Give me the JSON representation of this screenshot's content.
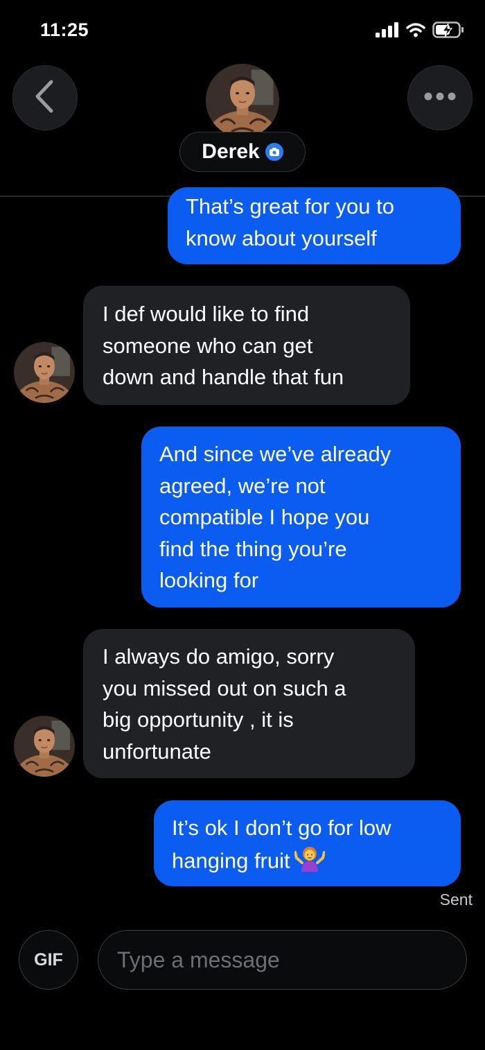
{
  "status_bar": {
    "time": "11:25",
    "icons": [
      "signal-icon",
      "wifi-icon",
      "battery-charging-icon"
    ]
  },
  "header": {
    "contact_name": "Derek",
    "back_icon": "chevron-left-icon",
    "more_icon": "more-dots-icon",
    "verified_icon": "camera-verified-icon"
  },
  "messages": [
    {
      "direction": "sent",
      "lines": [
        "That’s great for you to",
        "know about yourself"
      ]
    },
    {
      "direction": "received",
      "lines": [
        "I def would like to find",
        "someone who can get",
        "down and handle that fun"
      ]
    },
    {
      "direction": "sent",
      "lines": [
        "And since we’ve already",
        "agreed, we’re not",
        "compatible I hope you",
        "find the thing you’re",
        "looking for"
      ]
    },
    {
      "direction": "received",
      "lines": [
        "I always do amigo, sorry",
        "you missed out on such a",
        "big opportunity , it is",
        "unfortunate"
      ]
    },
    {
      "direction": "sent",
      "lines": [
        "It’s ok I don’t go for low",
        "hanging fruit"
      ],
      "emoji": "person-shrugging-icon"
    }
  ],
  "delivery_status": "Sent",
  "composer": {
    "gif_label": "GIF",
    "placeholder": "Type a message"
  },
  "colors": {
    "background": "#000000",
    "sent_bubble": "#0b5cf0",
    "received_bubble": "#1f2125",
    "verified_badge": "#2f7df6"
  }
}
